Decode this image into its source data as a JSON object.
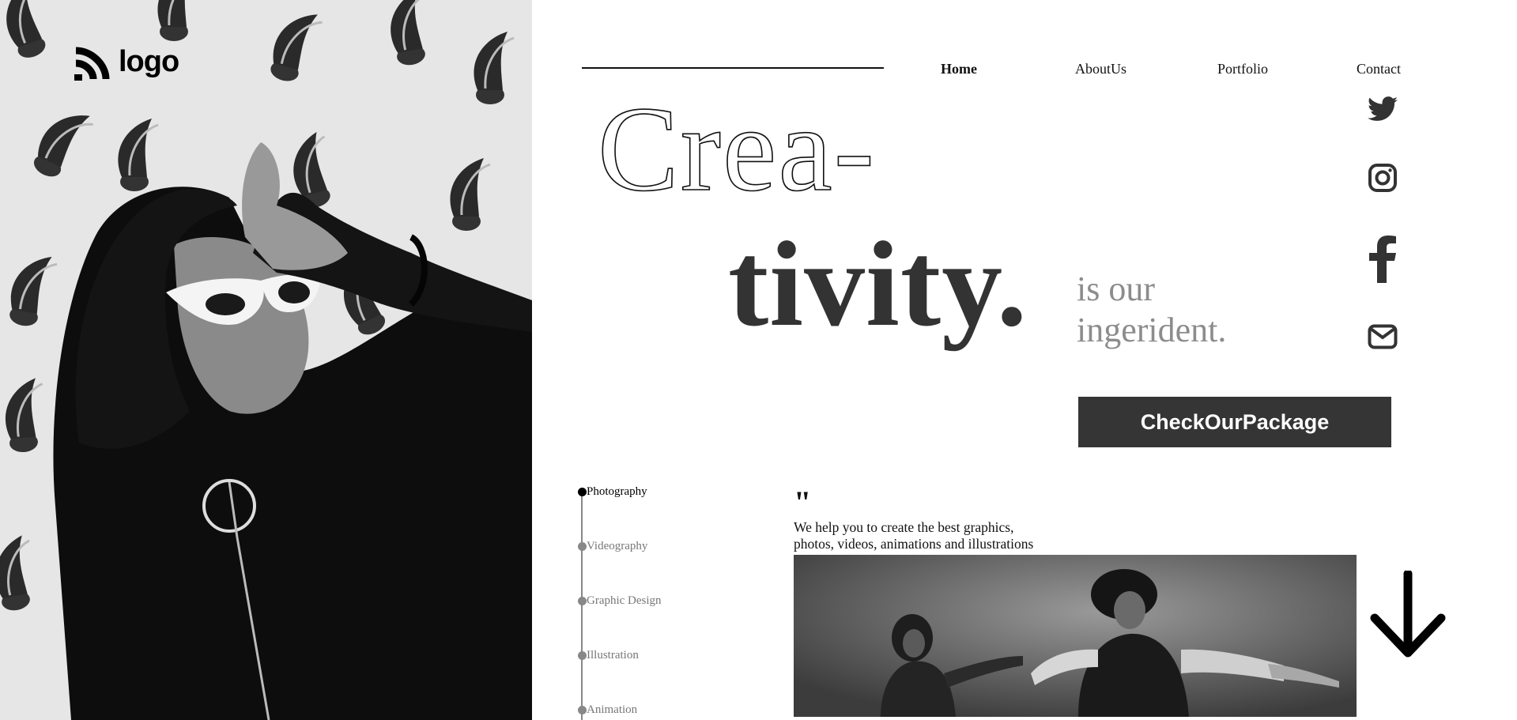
{
  "brand": {
    "logo_text": "logo"
  },
  "nav": {
    "items": [
      {
        "label": "Home",
        "active": true
      },
      {
        "label": "AboutUs",
        "active": false
      },
      {
        "label": "Portfolio",
        "active": false
      },
      {
        "label": "Contact",
        "active": false
      }
    ]
  },
  "hero": {
    "headline_line1": "Crea-",
    "headline_line2": "tivity.",
    "tagline_line1": "is our",
    "tagline_line2": "ingerident.",
    "cta_label": "CheckOurPackage"
  },
  "social": [
    "twitter-icon",
    "instagram-icon",
    "facebook-icon",
    "mail-icon"
  ],
  "services": {
    "items": [
      "Photography",
      "Videography",
      "Graphic Design",
      "Illustration",
      "Animation"
    ],
    "active_index": 0
  },
  "quote": {
    "mark": "\"",
    "line1": "We help you to create the best graphics,",
    "line2": "photos, videos, animations and illustrations"
  },
  "colors": {
    "cta_background": "#353535",
    "tagline": "#8c8c8c",
    "headline_dark": "#333333",
    "timeline_inactive": "#888888"
  }
}
